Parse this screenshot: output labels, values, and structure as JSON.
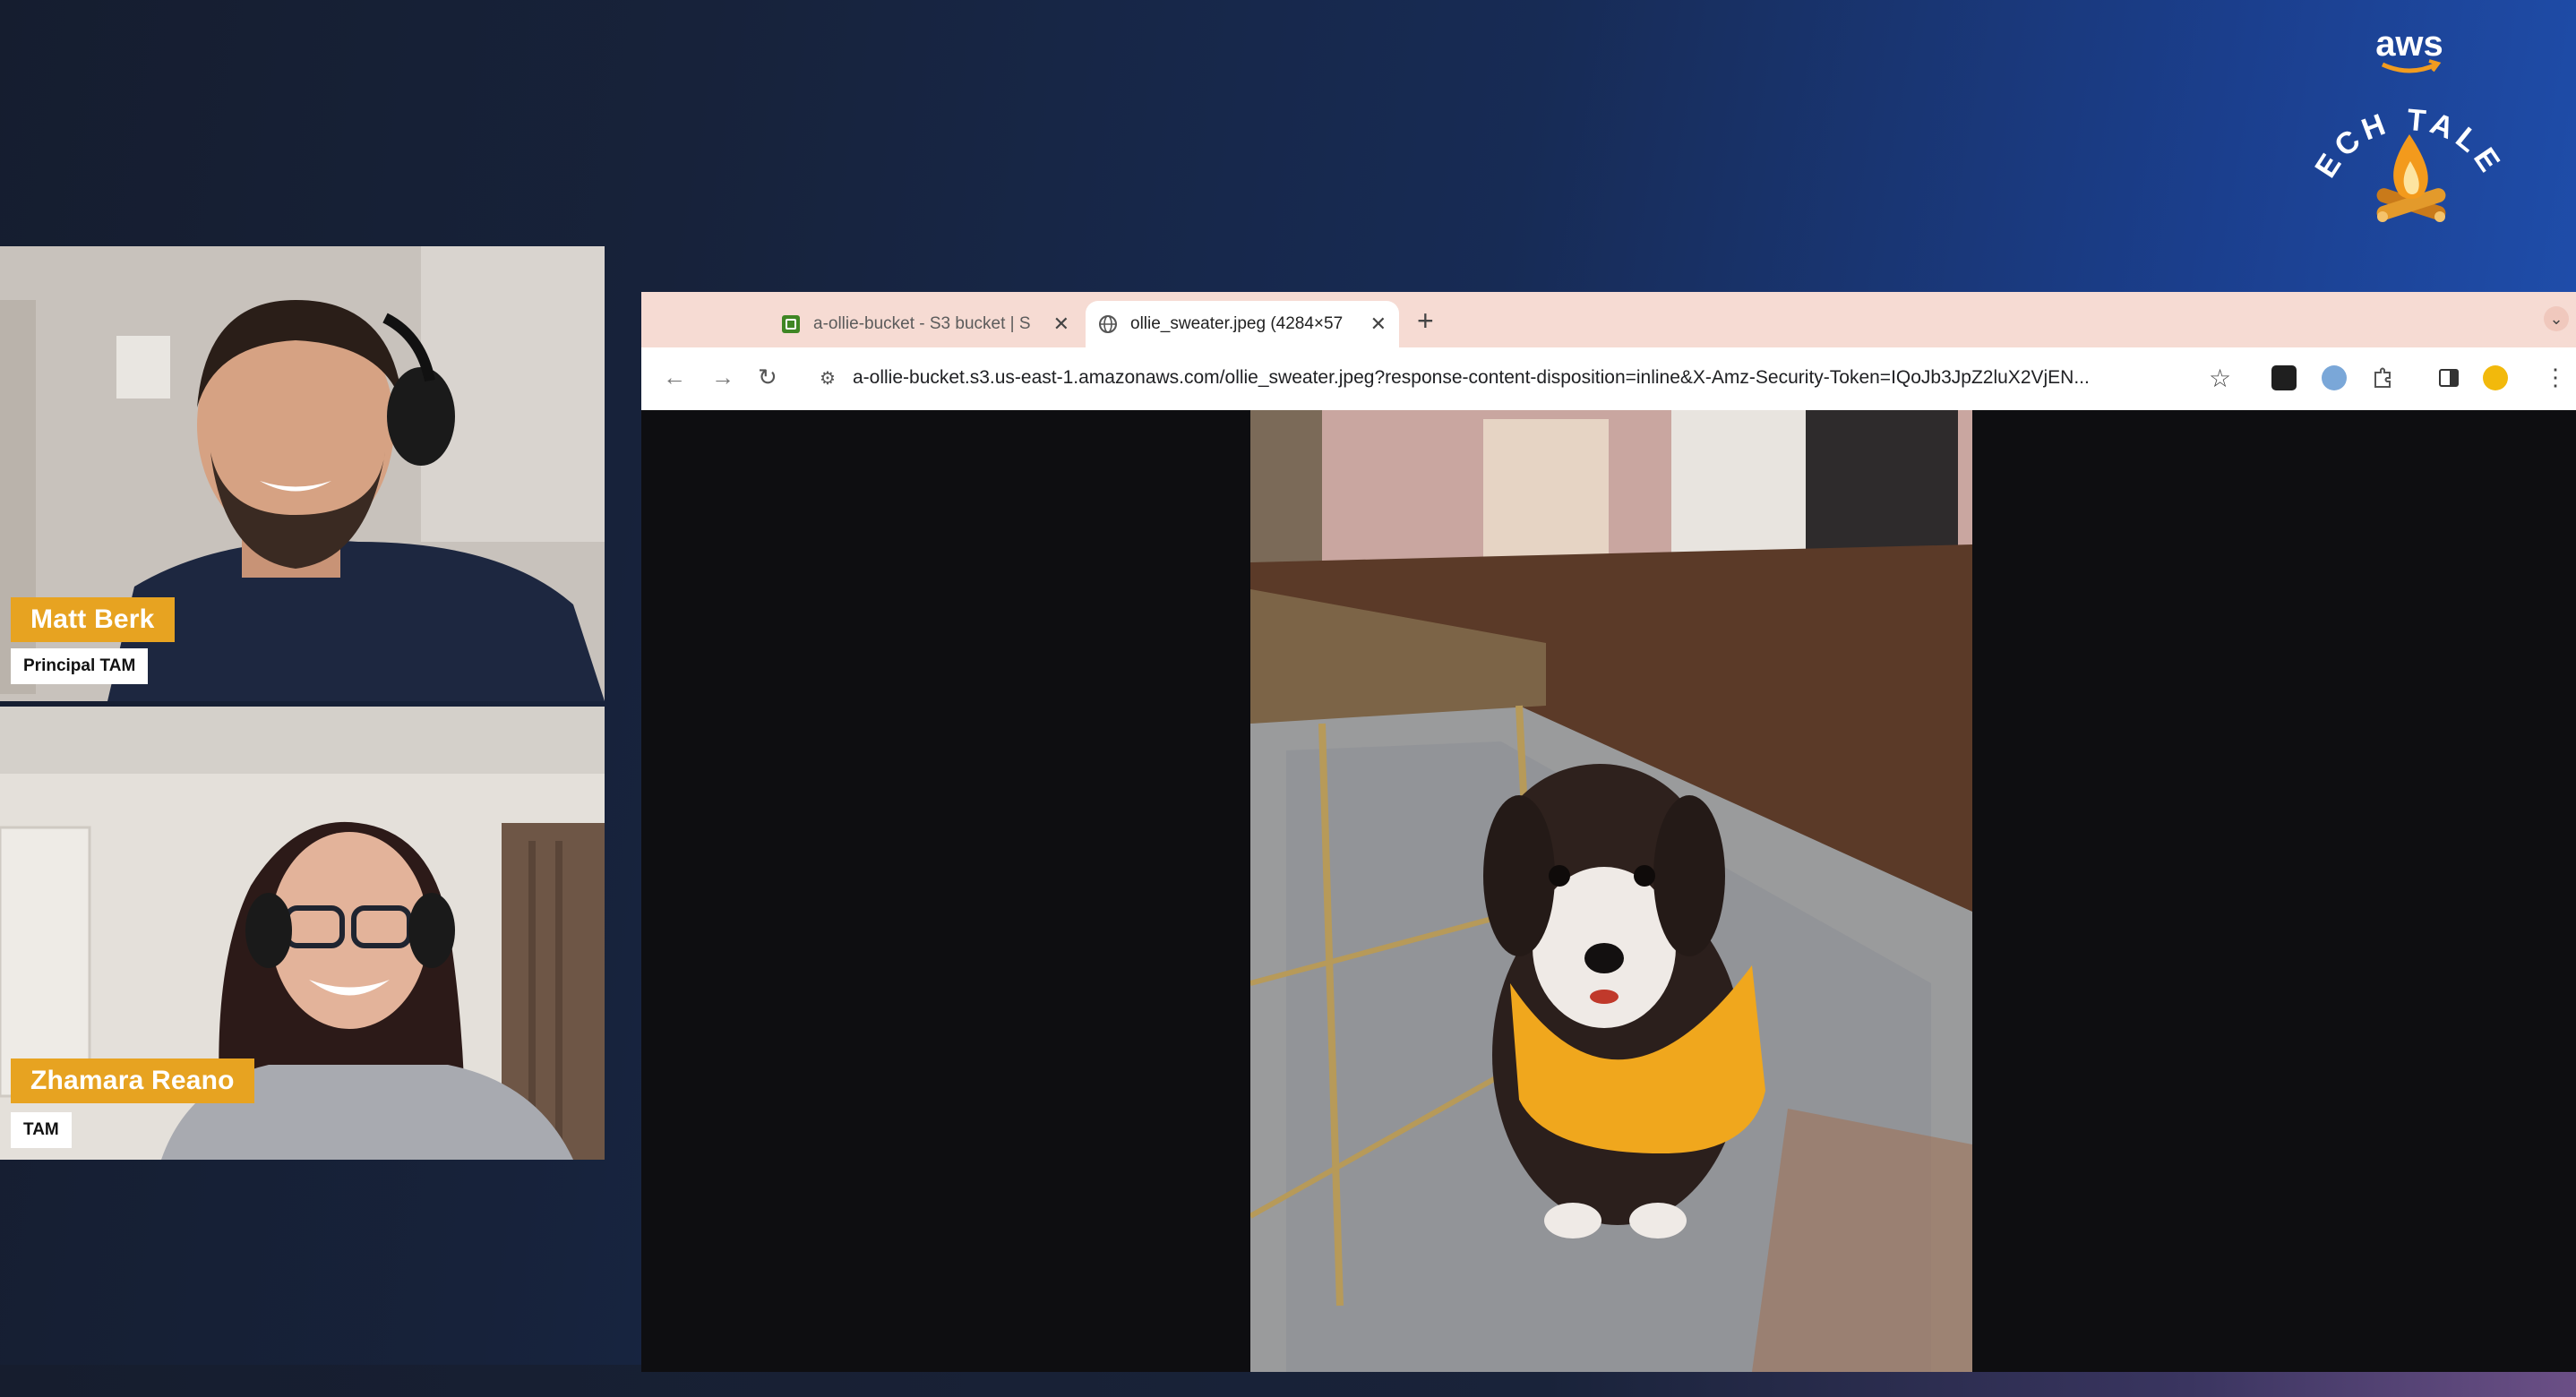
{
  "branding": {
    "aws_text": "aws",
    "show_text": "TECH TALES"
  },
  "participants": [
    {
      "name": "Matt Berk",
      "role": "Principal TAM"
    },
    {
      "name": "Zhamara Reano",
      "role": "TAM"
    }
  ],
  "browser": {
    "tabs": [
      {
        "title": "a-ollie-bucket - S3 bucket | S",
        "icon": "aws-s3-favicon",
        "active": false
      },
      {
        "title": "ollie_sweater.jpeg (4284×57",
        "icon": "globe-icon",
        "active": true
      }
    ],
    "new_tab_label": "+",
    "url": "a-ollie-bucket.s3.us-east-1.amazonaws.com/ollie_sweater.jpeg?response-content-disposition=inline&X-Amz-Security-Token=IQoJb3JpZ2luX2VjEN...",
    "image_subject": "dog-in-yellow-sweater-photo"
  },
  "colors": {
    "name_tag_bg": "#e7a321",
    "tabbar_bg": "#f6dbd3",
    "viewport_bg": "#0e0e11"
  }
}
